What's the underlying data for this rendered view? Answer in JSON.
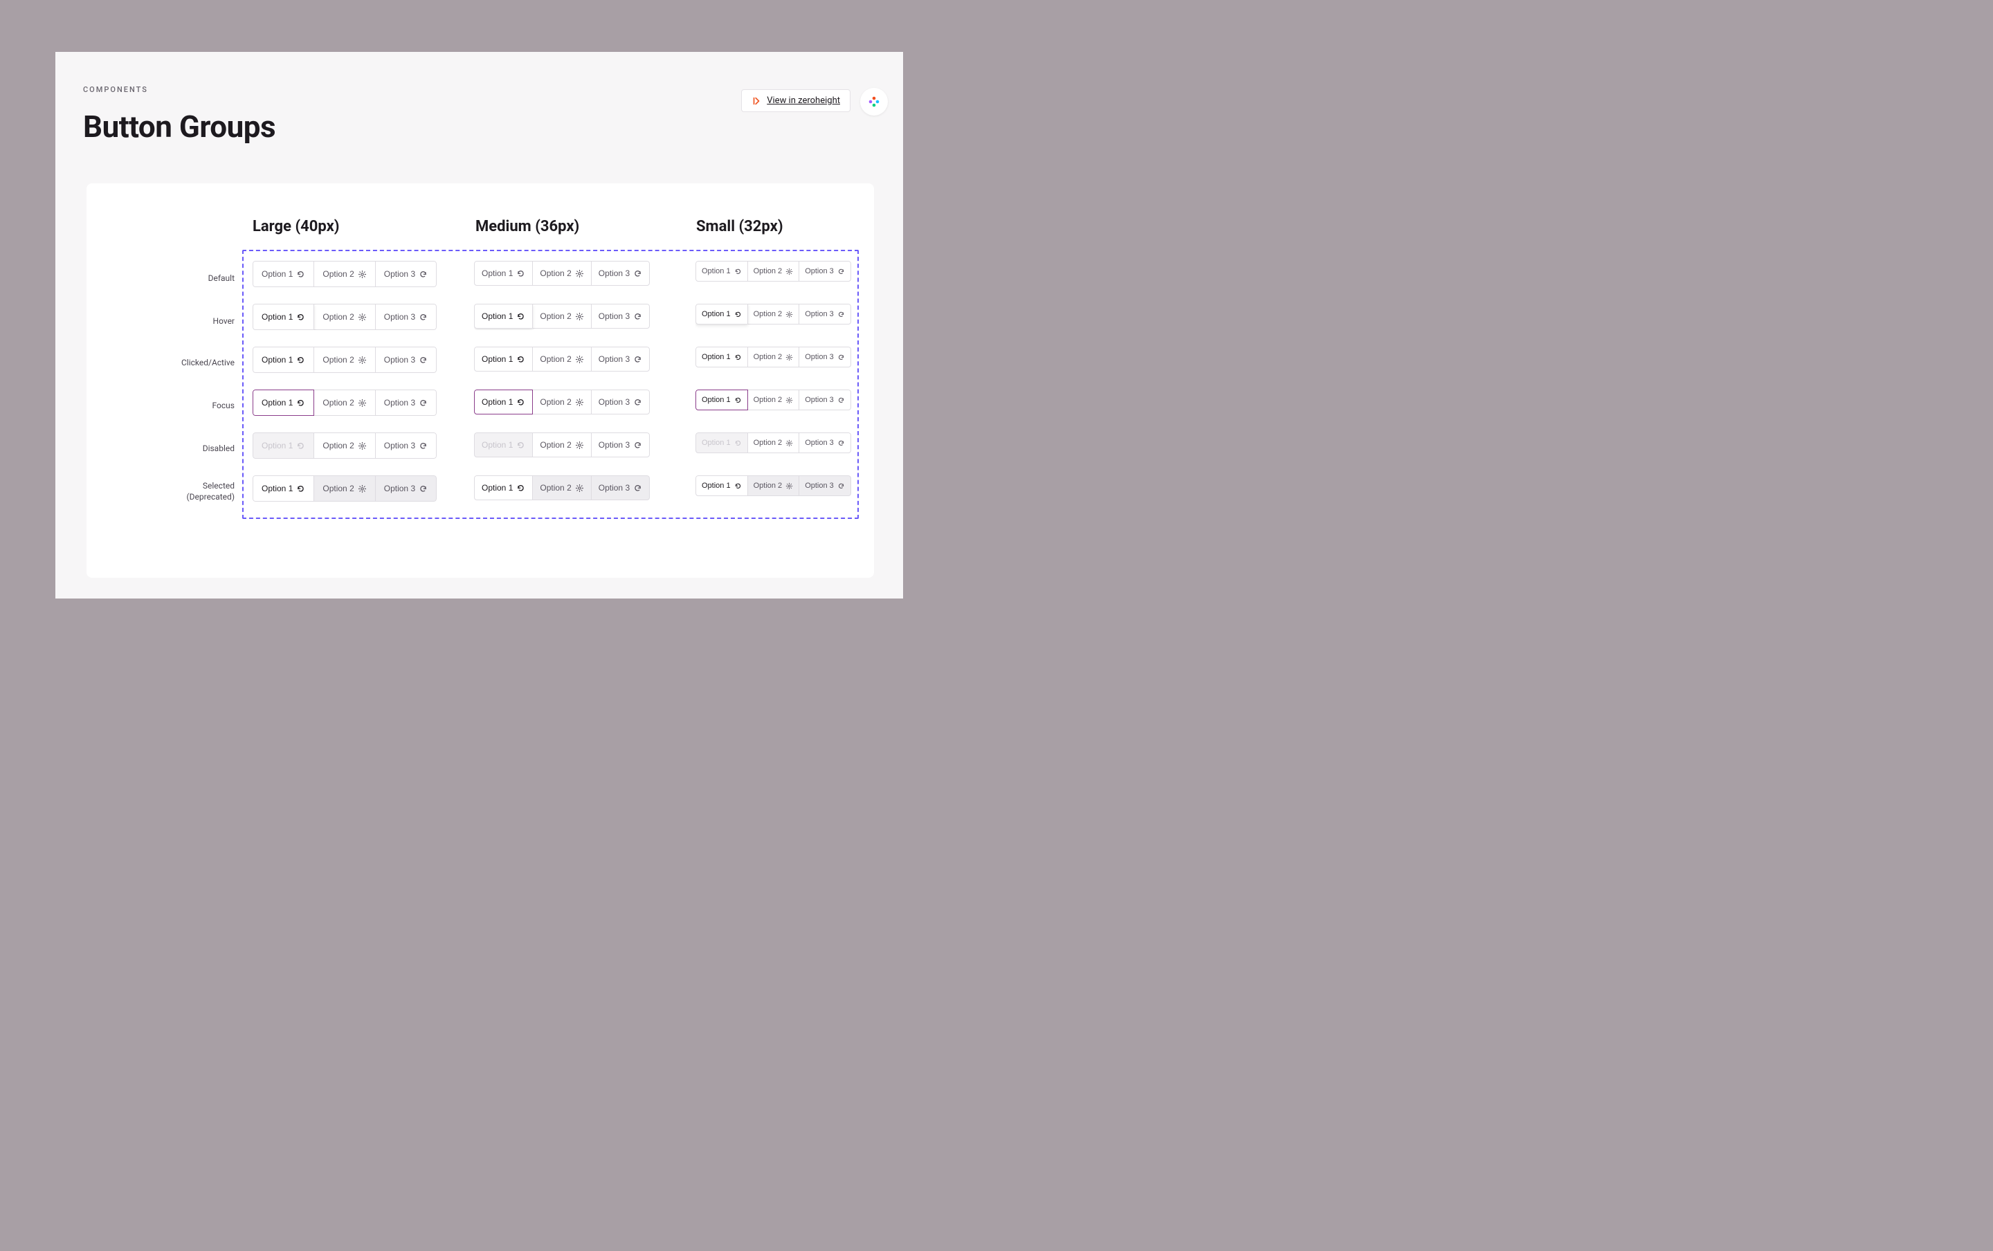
{
  "eyebrow": "COMPONENTS",
  "title": "Button Groups",
  "viewLink": "View in zeroheight",
  "columns": {
    "large": "Large (40px)",
    "medium": "Medium (36px)",
    "small": "Small (32px)"
  },
  "rowLabels": {
    "default": "Default",
    "hover": "Hover",
    "active": "Clicked/Active",
    "focus": "Focus",
    "disabled": "Disabled",
    "selected": "Selected (Deprecated)"
  },
  "options": {
    "opt1": "Option 1",
    "opt2": "Option 2",
    "opt3": "Option 3"
  },
  "states": [
    "default",
    "hover",
    "active",
    "focus",
    "disabled",
    "selected"
  ]
}
